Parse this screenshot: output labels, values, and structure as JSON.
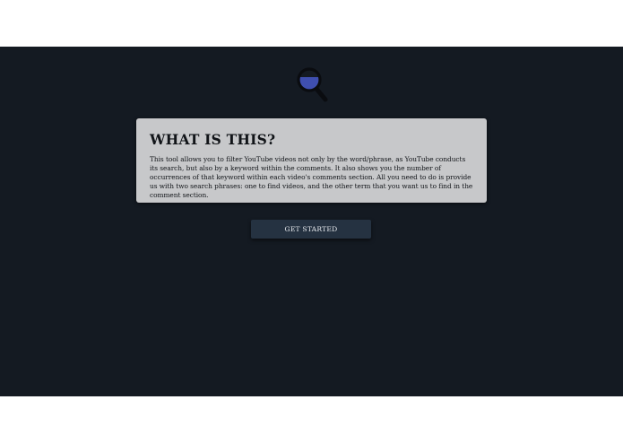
{
  "logo": {
    "icon": "magnifying-glass-icon",
    "colors": {
      "lens": "#3f4fb0",
      "frame": "#0a0c10"
    }
  },
  "info_card": {
    "title": "WHAT IS THIS?",
    "body": "This tool allows you to filter YouTube videos not only by the word/phrase, as YouTube conducts its search, but also by a keyword within the comments. It also shows you the number of occurrences of that keyword within each video's comments section. All you need to do is provide us with two search phrases: one to find videos, and the other term that you want us to find in the comment section."
  },
  "actions": {
    "get_started_label": "GET STARTED"
  },
  "colors": {
    "background": "#141a22",
    "card": "#c7c8ca",
    "button": "#253241"
  }
}
